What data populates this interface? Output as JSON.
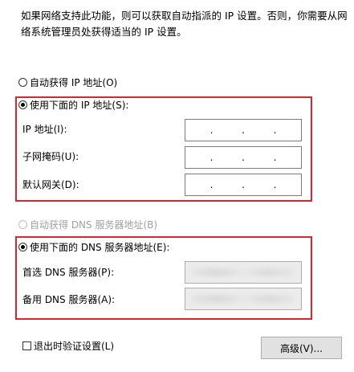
{
  "description": {
    "line1": "如果网络支持此功能，则可以获取自动指派的 IP 设置。否则，你需要从网",
    "line2": "络系统管理员处获得适当的 IP 设置。"
  },
  "ip": {
    "auto_option": "自动获得 IP 地址(O)",
    "manual_option": "使用下面的 IP 地址(S):",
    "fields": [
      {
        "label": "IP 地址(I):",
        "value": ". . ."
      },
      {
        "label": "子网掩码(U):",
        "value": ". . ."
      },
      {
        "label": "默认网关(D):",
        "value": ". . ."
      }
    ]
  },
  "dns": {
    "auto_option": "自动获得 DNS 服务器地址(B)",
    "manual_option": "使用下面的 DNS 服务器地址(E):",
    "fields": [
      {
        "label": "首选 DNS 服务器(P):"
      },
      {
        "label": "备用 DNS 服务器(A):"
      }
    ]
  },
  "footer": {
    "validate_checkbox": "退出时验证设置(L)",
    "advanced_button": "高级(V)..."
  },
  "colors": {
    "highlight_border": "#d9262c",
    "disabled_text": "#a0a0a0",
    "button_bg": "#e1e1e1"
  }
}
